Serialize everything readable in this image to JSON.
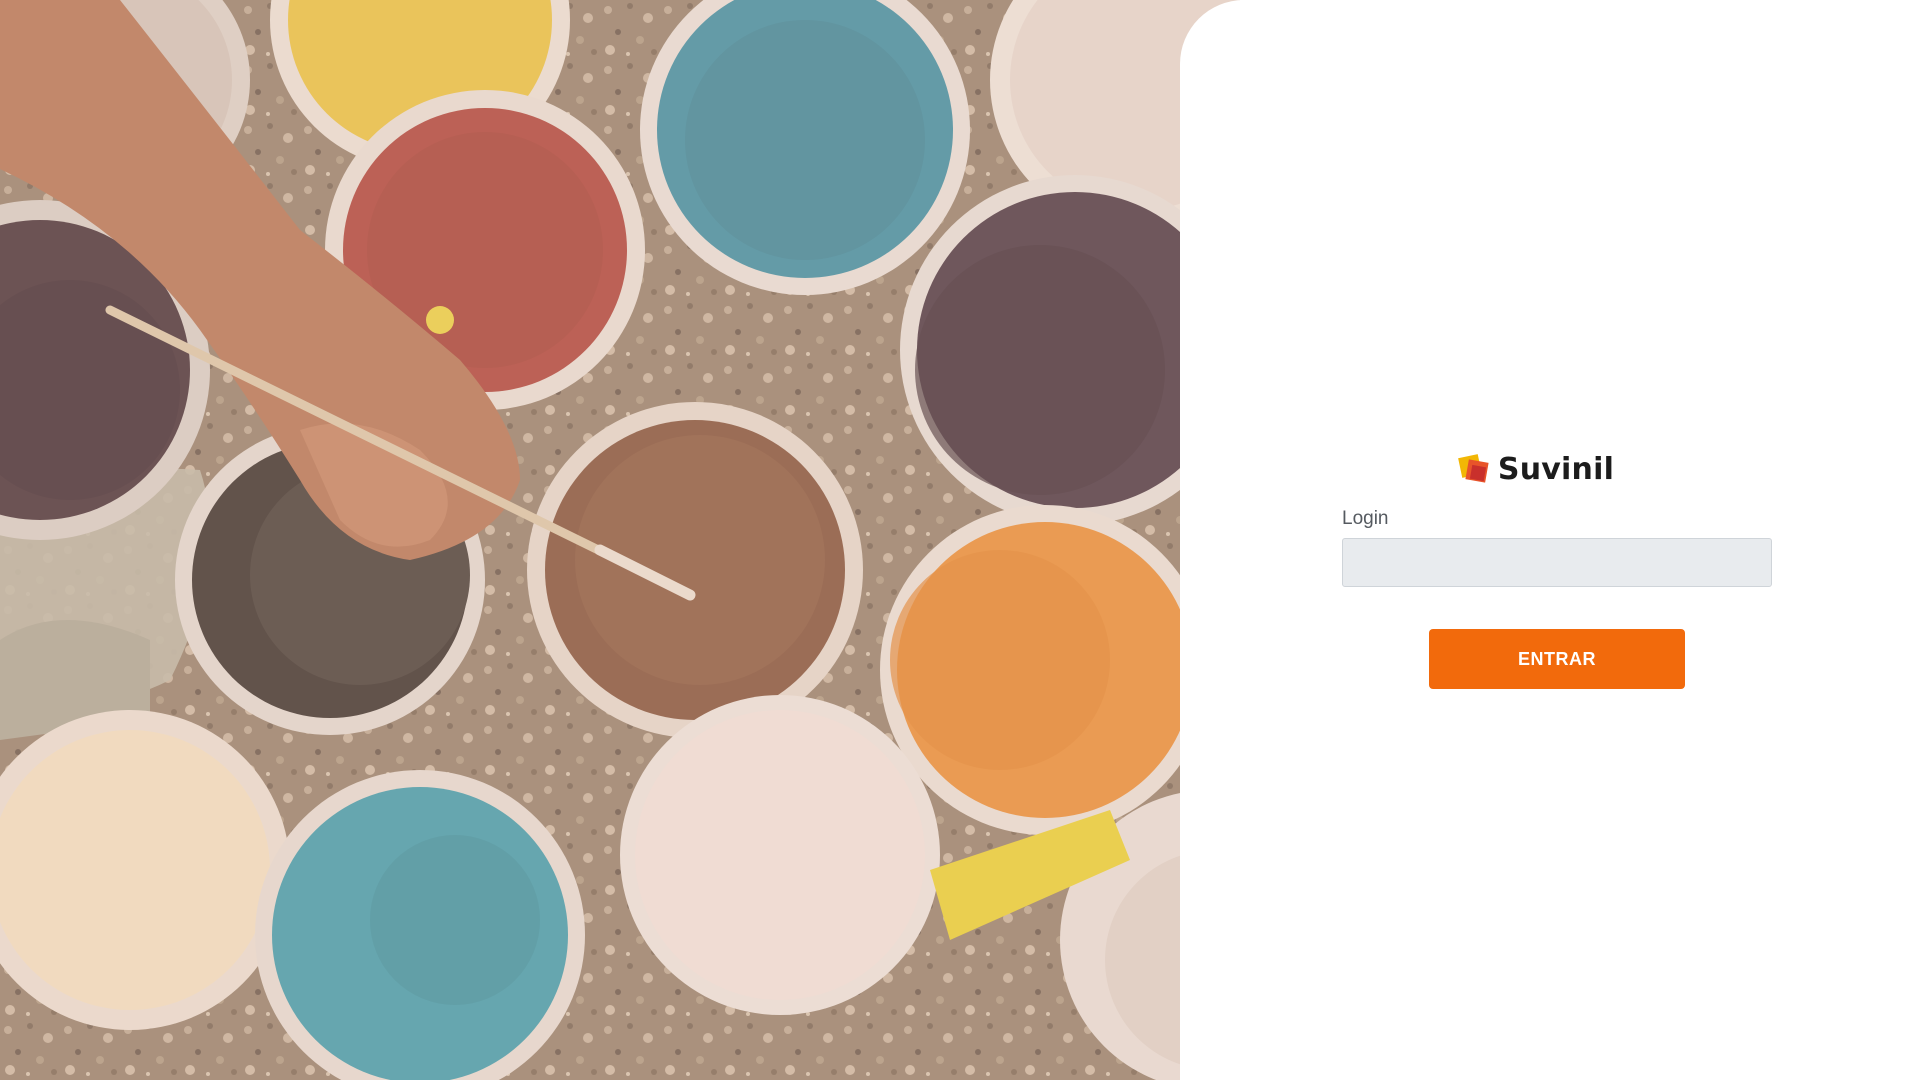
{
  "brand": {
    "name": "Suvinil",
    "logo_icon": "suvinil-logo-icon",
    "logo_colors": [
      "#f2b705",
      "#e8542a",
      "#c9302c"
    ]
  },
  "login_form": {
    "label": "Login",
    "value": "",
    "submit_label": "ENTRAR"
  },
  "colors": {
    "accent": "#f26a0c",
    "input_background": "#e8ebee",
    "label": "#555a60",
    "panel_background": "#ffffff"
  },
  "hero_image": {
    "subject": "paint-buckets-photo"
  }
}
